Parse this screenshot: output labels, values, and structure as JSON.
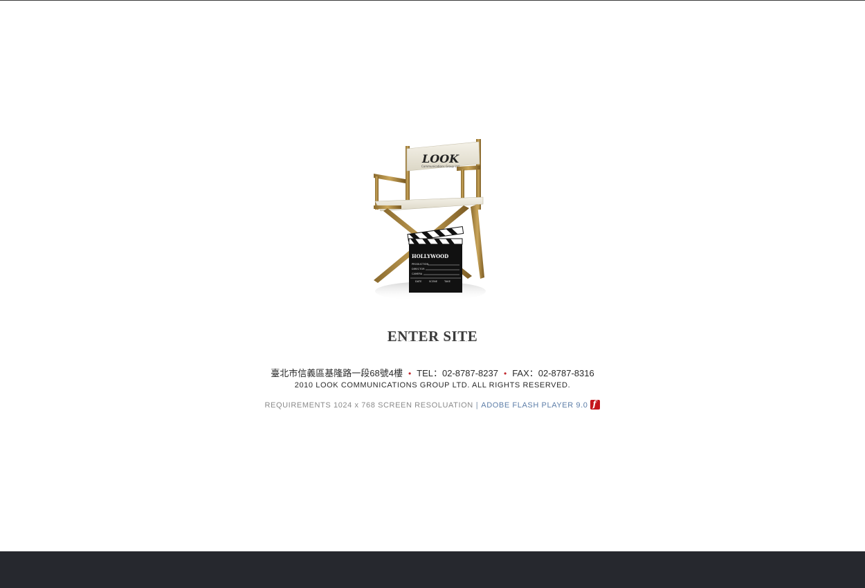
{
  "hero": {
    "chair_backrest_text": "LOOK",
    "chair_backrest_subtext": "Communications Group Ltd.",
    "clapper_title": "HOLLYWOOD",
    "clapper_rows": [
      "PRODUCTION",
      "DIRECTOR",
      "CAMERA"
    ],
    "clapper_footer": [
      "DATE",
      "SCENE",
      "TAKE"
    ]
  },
  "enter_label": "ENTER SITE",
  "contact": {
    "address": "臺北市信義區基隆路一段68號4樓",
    "separator": "•",
    "tel": "TEL：02-8787-8237",
    "fax": "FAX：02-8787-8316"
  },
  "copyright": "2010 LOOK COMMUNICATIONS GROUP LTD.  ALL RIGHTS RESERVED.",
  "requirements": {
    "text": "REQUIREMENTS 1024 x 768 SCREEN RESOLUATION",
    "pipe": "|",
    "flash_link": "ADOBE FLASH PLAYER 9.0",
    "flash_icon": "adobe-flash-icon"
  },
  "colors": {
    "background": "#ffffff",
    "footer_bar": "#26282e",
    "separator_dot": "#c0262c",
    "link": "#5d7ea8"
  }
}
